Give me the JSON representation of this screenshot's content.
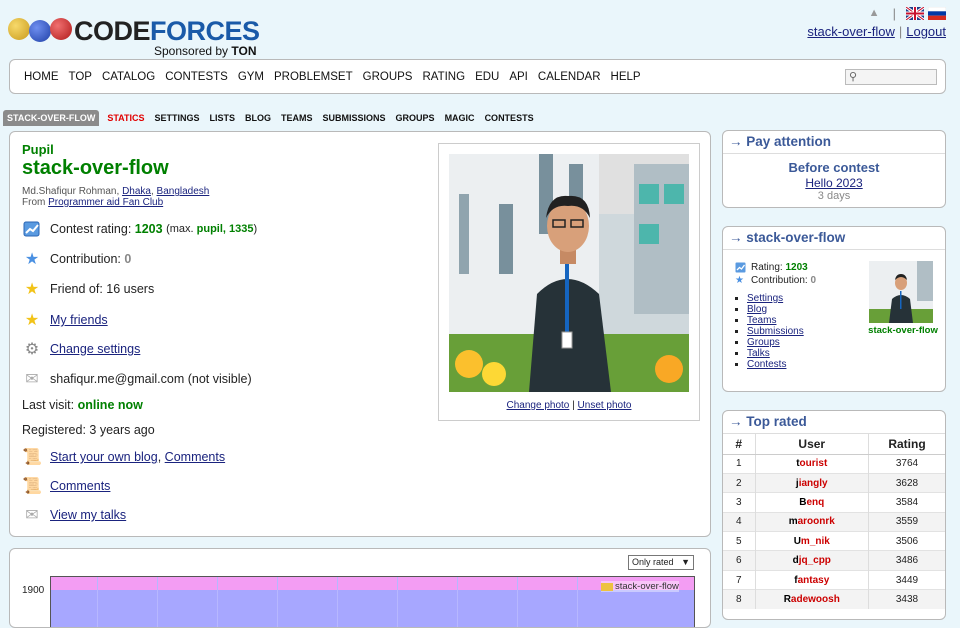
{
  "header": {
    "logo_part1": "CODE",
    "logo_part2": "FORCES",
    "sponsor_prefix": "Sponsored by",
    "sponsor_name": "TON",
    "user_link": "stack-over-flow",
    "separator": "|",
    "logout": "Logout"
  },
  "menu": {
    "items": [
      "HOME",
      "TOP",
      "CATALOG",
      "CONTESTS",
      "GYM",
      "PROBLEMSET",
      "GROUPS",
      "RATING",
      "EDU",
      "API",
      "CALENDAR",
      "HELP"
    ]
  },
  "submenu": {
    "items": [
      "STACK-OVER-FLOW",
      "STATICS",
      "SETTINGS",
      "LISTS",
      "BLOG",
      "TEAMS",
      "SUBMISSIONS",
      "GROUPS",
      "MAGIC",
      "CONTESTS"
    ]
  },
  "profile": {
    "rank": "Pupil",
    "handle": "stack-over-flow",
    "name_prefix": "Md.Shafiqur Rohman,",
    "city": "Dhaka",
    "comma": ",",
    "country": "Bangladesh",
    "from_prefix": "From",
    "organization": "Programmer aid Fan Club",
    "contest_rating_label": "Contest rating:",
    "contest_rating": "1203",
    "max_prefix": "(max.",
    "max_rank": "pupil, 1335",
    "max_suffix": ")",
    "contribution_label": "Contribution:",
    "contribution": "0",
    "friend_of": "Friend of: 16 users",
    "my_friends": "My friends",
    "change_settings": "Change settings",
    "email": "shafiqur.me@gmail.com (not visible)",
    "last_visit_label": "Last visit:",
    "last_visit": "online now",
    "registered": "Registered: 3 years ago",
    "start_blog": "Start your own blog",
    "blog_comma": ",",
    "comments_inline": "Comments",
    "comments": "Comments",
    "view_talks": "View my talks",
    "change_photo": "Change photo",
    "photo_sep": "|",
    "unset_photo": "Unset photo"
  },
  "pay_attention": {
    "title": "→ Pay attention",
    "before_contest": "Before contest",
    "contest_name": "Hello 2023",
    "time_left": "3 days"
  },
  "side_profile": {
    "title": "→ stack-over-flow",
    "rating_label": "Rating:",
    "rating": "1203",
    "contribution_label": "Contribution:",
    "contribution": "0",
    "links": [
      "Settings",
      "Blog",
      "Teams",
      "Submissions",
      "Groups",
      "Talks",
      "Contests"
    ],
    "photo_label": "stack-over-flow"
  },
  "top_rated": {
    "title": "→ Top rated",
    "headers": [
      "#",
      "User",
      "Rating"
    ],
    "rows": [
      {
        "n": "1",
        "first": "t",
        "rest": "ourist",
        "rating": "3764"
      },
      {
        "n": "2",
        "first": "j",
        "rest": "iangly",
        "rating": "3628"
      },
      {
        "n": "3",
        "first": "B",
        "rest": "enq",
        "rating": "3584"
      },
      {
        "n": "4",
        "first": "m",
        "rest": "aroonrk",
        "rating": "3559"
      },
      {
        "n": "5",
        "first": "U",
        "rest": "m_nik",
        "rating": "3506"
      },
      {
        "n": "6",
        "first": "d",
        "rest": "jq_cpp",
        "rating": "3486"
      },
      {
        "n": "7",
        "first": "f",
        "rest": "antasy",
        "rating": "3449"
      },
      {
        "n": "8",
        "first": "R",
        "rest": "adewoosh",
        "rating": "3438"
      }
    ]
  },
  "chart": {
    "select_value": "Only rated",
    "legend": "stack-over-flow",
    "y_tick": "1900"
  },
  "colors": {
    "pupil": "#008000",
    "legendary": "#cc0000",
    "link": "#1a237e",
    "box_title": "#3b5998"
  }
}
